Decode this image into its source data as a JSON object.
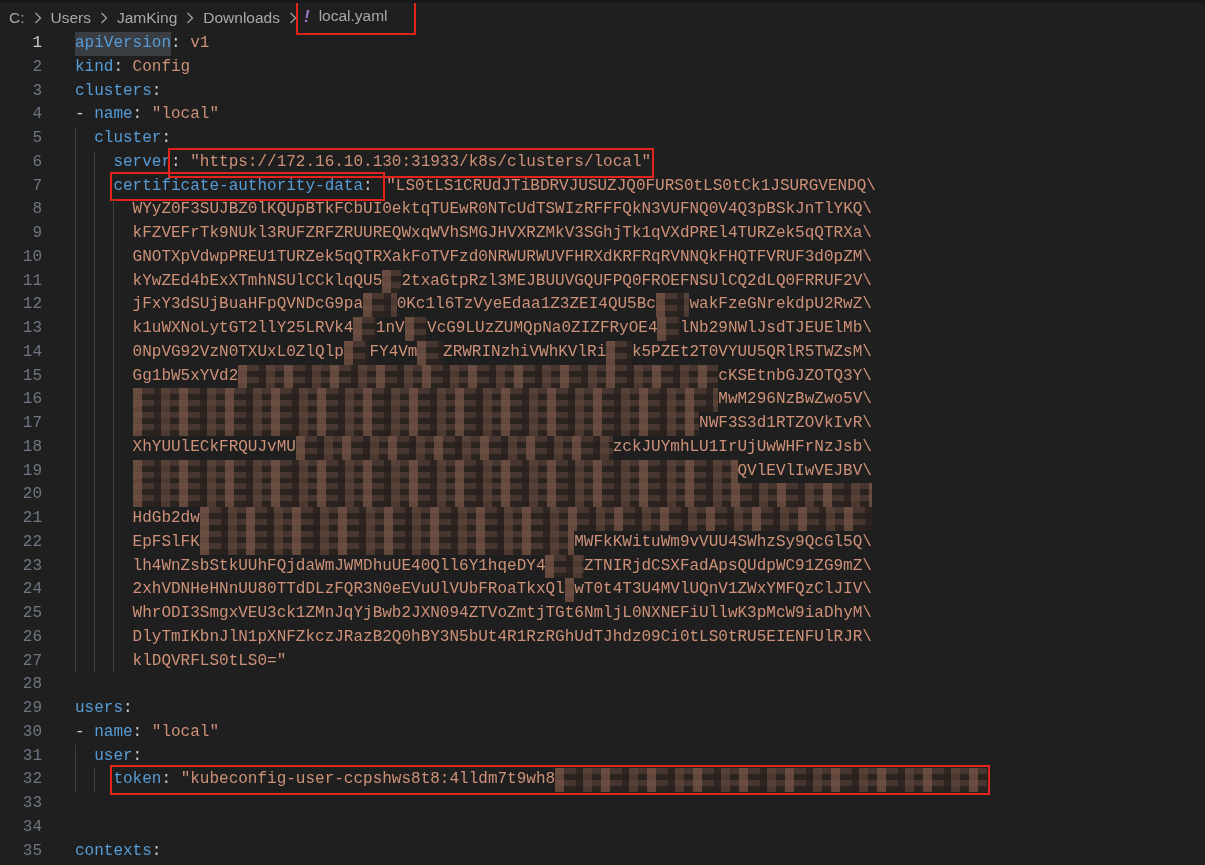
{
  "breadcrumb": {
    "folders": [
      "C:",
      "Users",
      "JamKing",
      "Downloads"
    ],
    "file": {
      "icon": "!",
      "name": "local.yaml",
      "annotated": true
    }
  },
  "lines": [
    {
      "number": "1",
      "current": true,
      "kind": "code",
      "tokens": [
        {
          "kind": "key",
          "text": "apiVersion"
        },
        {
          "kind": "punct",
          "text": ": "
        },
        {
          "kind": "string",
          "text": "v1"
        }
      ]
    },
    {
      "number": "2",
      "current": false,
      "kind": "code",
      "tokens": [
        {
          "kind": "key",
          "text": "kind"
        },
        {
          "kind": "punct",
          "text": ": "
        },
        {
          "kind": "string",
          "text": "Config"
        }
      ]
    },
    {
      "number": "3",
      "current": false,
      "kind": "code",
      "tokens": [
        {
          "kind": "key",
          "text": "clusters"
        },
        {
          "kind": "punct",
          "text": ":"
        }
      ]
    },
    {
      "number": "4",
      "current": false,
      "kind": "code",
      "tokens": [
        {
          "kind": "dash",
          "text": "- "
        },
        {
          "kind": "key",
          "text": "name"
        },
        {
          "kind": "punct",
          "text": ": "
        },
        {
          "kind": "string",
          "text": "\"local\""
        }
      ],
      "children": [
        {
          "number": "5",
          "current": false,
          "kind": "code",
          "tokens": [
            {
              "kind": "key",
              "text": "cluster"
            },
            {
              "kind": "punct",
              "text": ":"
            }
          ],
          "children": [
            {
              "number": "6",
              "current": false,
              "kind": "code",
              "tokens": [
                {
                  "kind": "key",
                  "text": "server"
                },
                {
                  "kind": "punct",
                  "text": ": ",
                  "annotated": true
                },
                {
                  "kind": "string",
                  "text": "\"https://172.16.10.130:31933/k8s/clusters/local\"",
                  "annotated": true
                }
              ]
            },
            {
              "number": "7",
              "current": false,
              "kind": "code",
              "tokens": [
                {
                  "kind": "key",
                  "text": "certificate-authority-data",
                  "annotated": true
                },
                {
                  "kind": "punct",
                  "text": ": ",
                  "annotated": true
                },
                {
                  "kind": "string",
                  "text": "\"LS0tLS1CRUdJTiBDRVJUSUZJQ0FURS0tLS0tCk1JSURGVENDQ\\"
                }
              ],
              "children": [
                {
                  "number": "8",
                  "current": false,
                  "kind": "blob",
                  "parts": [
                    {
                      "kind": "text",
                      "text": "WYyZ0F3SUJBZ0lKQUpBTkFCbUI0ektqTUEwR0NTcUdTSWIzRFFFQkN3VUFNQ0V4Q3pBSkJnTlYKQ\\"
                    }
                  ]
                },
                {
                  "number": "9",
                  "current": false,
                  "kind": "blob",
                  "parts": [
                    {
                      "kind": "text",
                      "text": "kFZVEFrTk9NUkl3RUFZRFZRUUREQWxqWVhSMGJHVXRZMkV3SGhjTk1qVXdPREl4TURZek5qQTRXa\\"
                    }
                  ]
                },
                {
                  "number": "10",
                  "current": false,
                  "kind": "blob",
                  "parts": [
                    {
                      "kind": "text",
                      "text": "GNOTXpVdwpPREU1TURZek5qQTRXakFoTVFzd0NRWURWUVFHRXdKRFRqRVNNQkFHQTFVRUF3d0pZM\\"
                    }
                  ]
                },
                {
                  "number": "11",
                  "current": false,
                  "kind": "blob",
                  "parts": [
                    {
                      "kind": "text",
                      "text": "kYwZEd4bExXTmhNSUlCCklqQU5"
                    },
                    {
                      "kind": "redacted"
                    },
                    {
                      "kind": "text",
                      "text": "2txaGtpRzl3MEJBUUVGQUFPQ0FROEFNSUlCQ2dLQ0FRRUF2V\\"
                    }
                  ]
                },
                {
                  "number": "12",
                  "current": false,
                  "kind": "blob",
                  "parts": [
                    {
                      "kind": "text",
                      "text": "jFxY3dSUjBuaHFpQVNDcG9pa"
                    },
                    {
                      "kind": "redacted"
                    },
                    {
                      "kind": "text",
                      "text": "0Kc1l6TzVyeEdaa1Z3ZEI4QU5Bc"
                    },
                    {
                      "kind": "redacted"
                    },
                    {
                      "kind": "text",
                      "text": "wakFzeGNrekdpU2RwZ\\"
                    }
                  ]
                },
                {
                  "number": "13",
                  "current": false,
                  "kind": "blob",
                  "parts": [
                    {
                      "kind": "text",
                      "text": "k1uWXNoLytGT2llY25LRVk4"
                    },
                    {
                      "kind": "redacted"
                    },
                    {
                      "kind": "text",
                      "text": "1nV"
                    },
                    {
                      "kind": "redacted"
                    },
                    {
                      "kind": "text",
                      "text": "VcG9LUzZUMQpNa0ZIZFRyOE4"
                    },
                    {
                      "kind": "redacted"
                    },
                    {
                      "kind": "text",
                      "text": "lNb29NWlJsdTJEUElMb\\"
                    }
                  ]
                },
                {
                  "number": "14",
                  "current": false,
                  "kind": "blob",
                  "parts": [
                    {
                      "kind": "text",
                      "text": "0NpVG92VzN0TXUxL0ZlQlp"
                    },
                    {
                      "kind": "redacted"
                    },
                    {
                      "kind": "text",
                      "text": "FY4Vm"
                    },
                    {
                      "kind": "redacted"
                    },
                    {
                      "kind": "text",
                      "text": "ZRWRINzhiVWhKVlRi"
                    },
                    {
                      "kind": "redacted"
                    },
                    {
                      "kind": "text",
                      "text": "k5PZEt2T0VYUU5QRlR5TWZsM\\"
                    }
                  ]
                },
                {
                  "number": "15",
                  "current": false,
                  "kind": "blob",
                  "parts": [
                    {
                      "kind": "text",
                      "text": "Gg1bW5xYVd2"
                    },
                    {
                      "kind": "redacted"
                    },
                    {
                      "kind": "text",
                      "text": "cKSEtnbGJZOTQ3Y\\"
                    }
                  ]
                },
                {
                  "number": "16",
                  "current": false,
                  "kind": "blob",
                  "parts": [
                    {
                      "kind": "redacted"
                    },
                    {
                      "kind": "text",
                      "text": "MwM296NzBwZwo5V\\"
                    }
                  ]
                },
                {
                  "number": "17",
                  "current": false,
                  "kind": "blob",
                  "parts": [
                    {
                      "kind": "redacted"
                    },
                    {
                      "kind": "text",
                      "text": "NWF3S3d1RTZOVkIvR\\"
                    }
                  ]
                },
                {
                  "number": "18",
                  "current": false,
                  "kind": "blob",
                  "parts": [
                    {
                      "kind": "text",
                      "text": "XhYUUlECkFRQUJvMU"
                    },
                    {
                      "kind": "redacted"
                    },
                    {
                      "kind": "text",
                      "text": "zckJUYmhLU1IrUjUwWHFrNzJsb\\"
                    }
                  ]
                },
                {
                  "number": "19",
                  "current": false,
                  "kind": "blob",
                  "parts": [
                    {
                      "kind": "redacted"
                    },
                    {
                      "kind": "text",
                      "text": "QVlEVlIwVEJBV\\"
                    }
                  ]
                },
                {
                  "number": "20",
                  "current": false,
                  "kind": "blob",
                  "parts": [
                    {
                      "kind": "redacted"
                    }
                  ]
                },
                {
                  "number": "21",
                  "current": false,
                  "kind": "blob",
                  "parts": [
                    {
                      "kind": "text",
                      "text": "HdGb2dw"
                    },
                    {
                      "kind": "redacted"
                    }
                  ]
                },
                {
                  "number": "22",
                  "current": false,
                  "kind": "blob",
                  "parts": [
                    {
                      "kind": "text",
                      "text": "EpFSlFK"
                    },
                    {
                      "kind": "redacted"
                    },
                    {
                      "kind": "text",
                      "text": "MWFkKWituWm9vVUU4SWhzSy9QcGl5Q\\"
                    }
                  ]
                },
                {
                  "number": "23",
                  "current": false,
                  "kind": "blob",
                  "parts": [
                    {
                      "kind": "text",
                      "text": "lh4WnZsbStkUUhFQjdaWmJWMDhuUE40Qll6Y1hqeDY4"
                    },
                    {
                      "kind": "redacted"
                    },
                    {
                      "kind": "text",
                      "text": "ZTNIRjdCSXFadApsQUdpWC91ZG9mZ\\"
                    }
                  ]
                },
                {
                  "number": "24",
                  "current": false,
                  "kind": "blob",
                  "parts": [
                    {
                      "kind": "text",
                      "text": "2xhVDNHeHNnUU80TTdDLzFQR3N0eEVuUlVUbFRoaTkxQl"
                    },
                    {
                      "kind": "redacted"
                    },
                    {
                      "kind": "text",
                      "text": "wT0t4T3U4MVlUQnV1ZWxYMFQzClJIV\\"
                    }
                  ]
                },
                {
                  "number": "25",
                  "current": false,
                  "kind": "blob",
                  "parts": [
                    {
                      "kind": "text",
                      "text": "WhrODI3SmgxVEU3ck1ZMnJqYjBwb2JXN094ZTVoZmtjTGt6NmljL0NXNEFiUllwK3pMcW9iaDhyM\\"
                    }
                  ]
                },
                {
                  "number": "26",
                  "current": false,
                  "kind": "blob",
                  "parts": [
                    {
                      "kind": "text",
                      "text": "DlyTmIKbnJlN1pXNFZkczJRazB2Q0hBY3N5bUt4R1RzRGhUdTJhdz09Ci0tLS0tRU5EIENFUlRJR\\"
                    }
                  ]
                },
                {
                  "number": "27",
                  "current": false,
                  "kind": "code",
                  "tokens": [
                    {
                      "kind": "string",
                      "text": "klDQVRFLS0tLS0=\""
                    }
                  ]
                }
              ]
            }
          ]
        }
      ]
    },
    {
      "number": "28",
      "current": false,
      "kind": "code"
    },
    {
      "number": "29",
      "current": false,
      "kind": "code",
      "tokens": [
        {
          "kind": "key",
          "text": "users"
        },
        {
          "kind": "punct",
          "text": ":"
        }
      ]
    },
    {
      "number": "30",
      "current": false,
      "kind": "code",
      "tokens": [
        {
          "kind": "dash",
          "text": "- "
        },
        {
          "kind": "key",
          "text": "name"
        },
        {
          "kind": "punct",
          "text": ": "
        },
        {
          "kind": "string",
          "text": "\"local\""
        }
      ],
      "children": [
        {
          "number": "31",
          "current": false,
          "kind": "code",
          "tokens": [
            {
              "kind": "key",
              "text": "user"
            },
            {
              "kind": "punct",
              "text": ":"
            }
          ],
          "children": [
            {
              "number": "32",
              "current": false,
              "kind": "code",
              "tokens": [
                {
                  "kind": "key",
                  "text": "token",
                  "annotated": true
                },
                {
                  "kind": "punct",
                  "text": ": ",
                  "annotated": true
                },
                {
                  "kind": "string",
                  "text": "\"kubeconfig-user-ccpshws8t8:4lldm7t9wh8",
                  "annotated": true
                },
                {
                  "kind": "redacted",
                  "annotated": true
                }
              ]
            }
          ]
        }
      ]
    },
    {
      "number": "33",
      "current": false,
      "kind": "code"
    },
    {
      "number": "34",
      "current": false,
      "kind": "code"
    },
    {
      "number": "35",
      "current": false,
      "kind": "code",
      "tokens": [
        {
          "kind": "key",
          "text": "contexts"
        },
        {
          "kind": "punct",
          "text": ":"
        }
      ]
    }
  ]
}
